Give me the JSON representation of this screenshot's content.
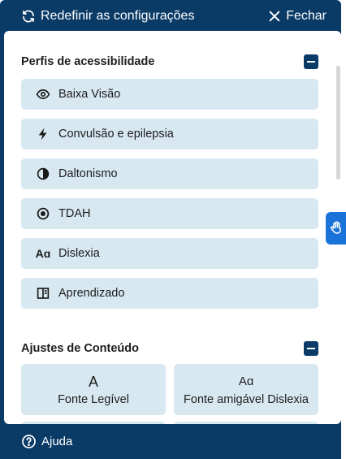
{
  "header": {
    "reset_label": "Redefinir as configurações",
    "close_label": "Fechar"
  },
  "profiles_section": {
    "title": "Perfis de acessibilidade",
    "items": [
      {
        "label": "Baixa Visão",
        "icon": "eye-icon"
      },
      {
        "label": "Convulsão e epilepsia",
        "icon": "lightning-icon"
      },
      {
        "label": "Daltonismo",
        "icon": "half-circle-icon"
      },
      {
        "label": "TDAH",
        "icon": "target-icon"
      },
      {
        "label": "Dislexia",
        "icon": "font-aa-icon"
      },
      {
        "label": "Aprendizado",
        "icon": "book-icon"
      }
    ]
  },
  "content_section": {
    "title": "Ajustes de Conteúdo",
    "tiles": [
      {
        "label": "Fonte Legível",
        "glyph": "A",
        "icon": "font-a-icon"
      },
      {
        "label": "Fonte amigável Dislexia",
        "glyph": "Aɑ",
        "icon": "font-aa-icon"
      }
    ]
  },
  "footer": {
    "help_label": "Ajuda"
  },
  "colors": {
    "panel": "#0a3a66",
    "item_bg": "#d8e8f1",
    "toggle": "#1a73d9"
  }
}
